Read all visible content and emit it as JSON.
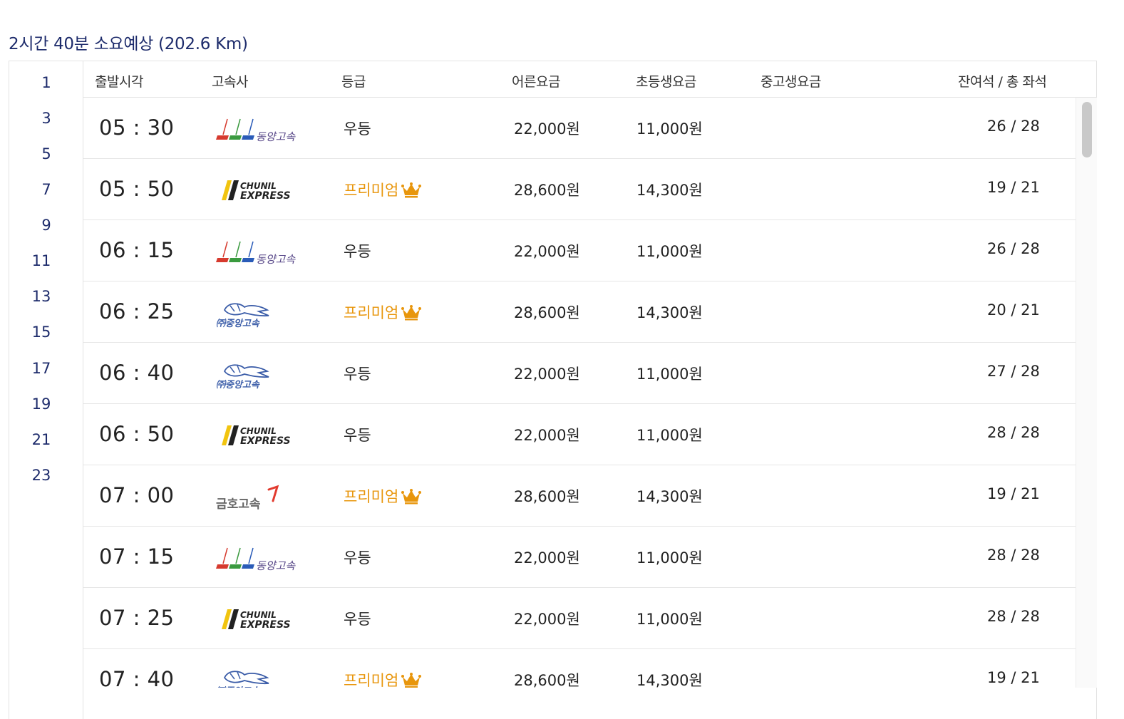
{
  "summary": {
    "text": "2시간 40분 소요예상 (202.6 Km)"
  },
  "hours": [
    "1",
    "3",
    "5",
    "7",
    "9",
    "11",
    "13",
    "15",
    "17",
    "19",
    "21",
    "23"
  ],
  "headers": {
    "departure": "출발시각",
    "company": "고속사",
    "grade": "등급",
    "adult": "어른요금",
    "child": "초등생요금",
    "student": "중고생요금",
    "seats": "잔여석 / 총 좌석"
  },
  "logos": {
    "dongyang": "동양고속",
    "chunil_1": "CHUNIL",
    "chunil_2": "EXPRESS",
    "joongang": "㈜중앙고속",
    "kumho": "금호고속"
  },
  "rows": [
    {
      "time": "05 : 30",
      "company": "dongyang",
      "grade": "우등",
      "premium": false,
      "adult": "22,000원",
      "child": "11,000원",
      "student": "",
      "seats": "26 / 28"
    },
    {
      "time": "05 : 50",
      "company": "chunil",
      "grade": "프리미엄",
      "premium": true,
      "adult": "28,600원",
      "child": "14,300원",
      "student": "",
      "seats": "19 / 21"
    },
    {
      "time": "06 : 15",
      "company": "dongyang",
      "grade": "우등",
      "premium": false,
      "adult": "22,000원",
      "child": "11,000원",
      "student": "",
      "seats": "26 / 28"
    },
    {
      "time": "06 : 25",
      "company": "joongang",
      "grade": "프리미엄",
      "premium": true,
      "adult": "28,600원",
      "child": "14,300원",
      "student": "",
      "seats": "20 / 21"
    },
    {
      "time": "06 : 40",
      "company": "joongang",
      "grade": "우등",
      "premium": false,
      "adult": "22,000원",
      "child": "11,000원",
      "student": "",
      "seats": "27 / 28"
    },
    {
      "time": "06 : 50",
      "company": "chunil",
      "grade": "우등",
      "premium": false,
      "adult": "22,000원",
      "child": "11,000원",
      "student": "",
      "seats": "28 / 28"
    },
    {
      "time": "07 : 00",
      "company": "kumho",
      "grade": "프리미엄",
      "premium": true,
      "adult": "28,600원",
      "child": "14,300원",
      "student": "",
      "seats": "19 / 21"
    },
    {
      "time": "07 : 15",
      "company": "dongyang",
      "grade": "우등",
      "premium": false,
      "adult": "22,000원",
      "child": "11,000원",
      "student": "",
      "seats": "28 / 28"
    },
    {
      "time": "07 : 25",
      "company": "chunil",
      "grade": "우등",
      "premium": false,
      "adult": "22,000원",
      "child": "11,000원",
      "student": "",
      "seats": "28 / 28"
    },
    {
      "time": "07 : 40",
      "company": "joongang",
      "grade": "프리미엄",
      "premium": true,
      "adult": "28,600원",
      "child": "14,300원",
      "student": "",
      "seats": "19 / 21"
    }
  ],
  "colors": {
    "navy": "#1d2b6b",
    "premium": "#e8960c"
  }
}
